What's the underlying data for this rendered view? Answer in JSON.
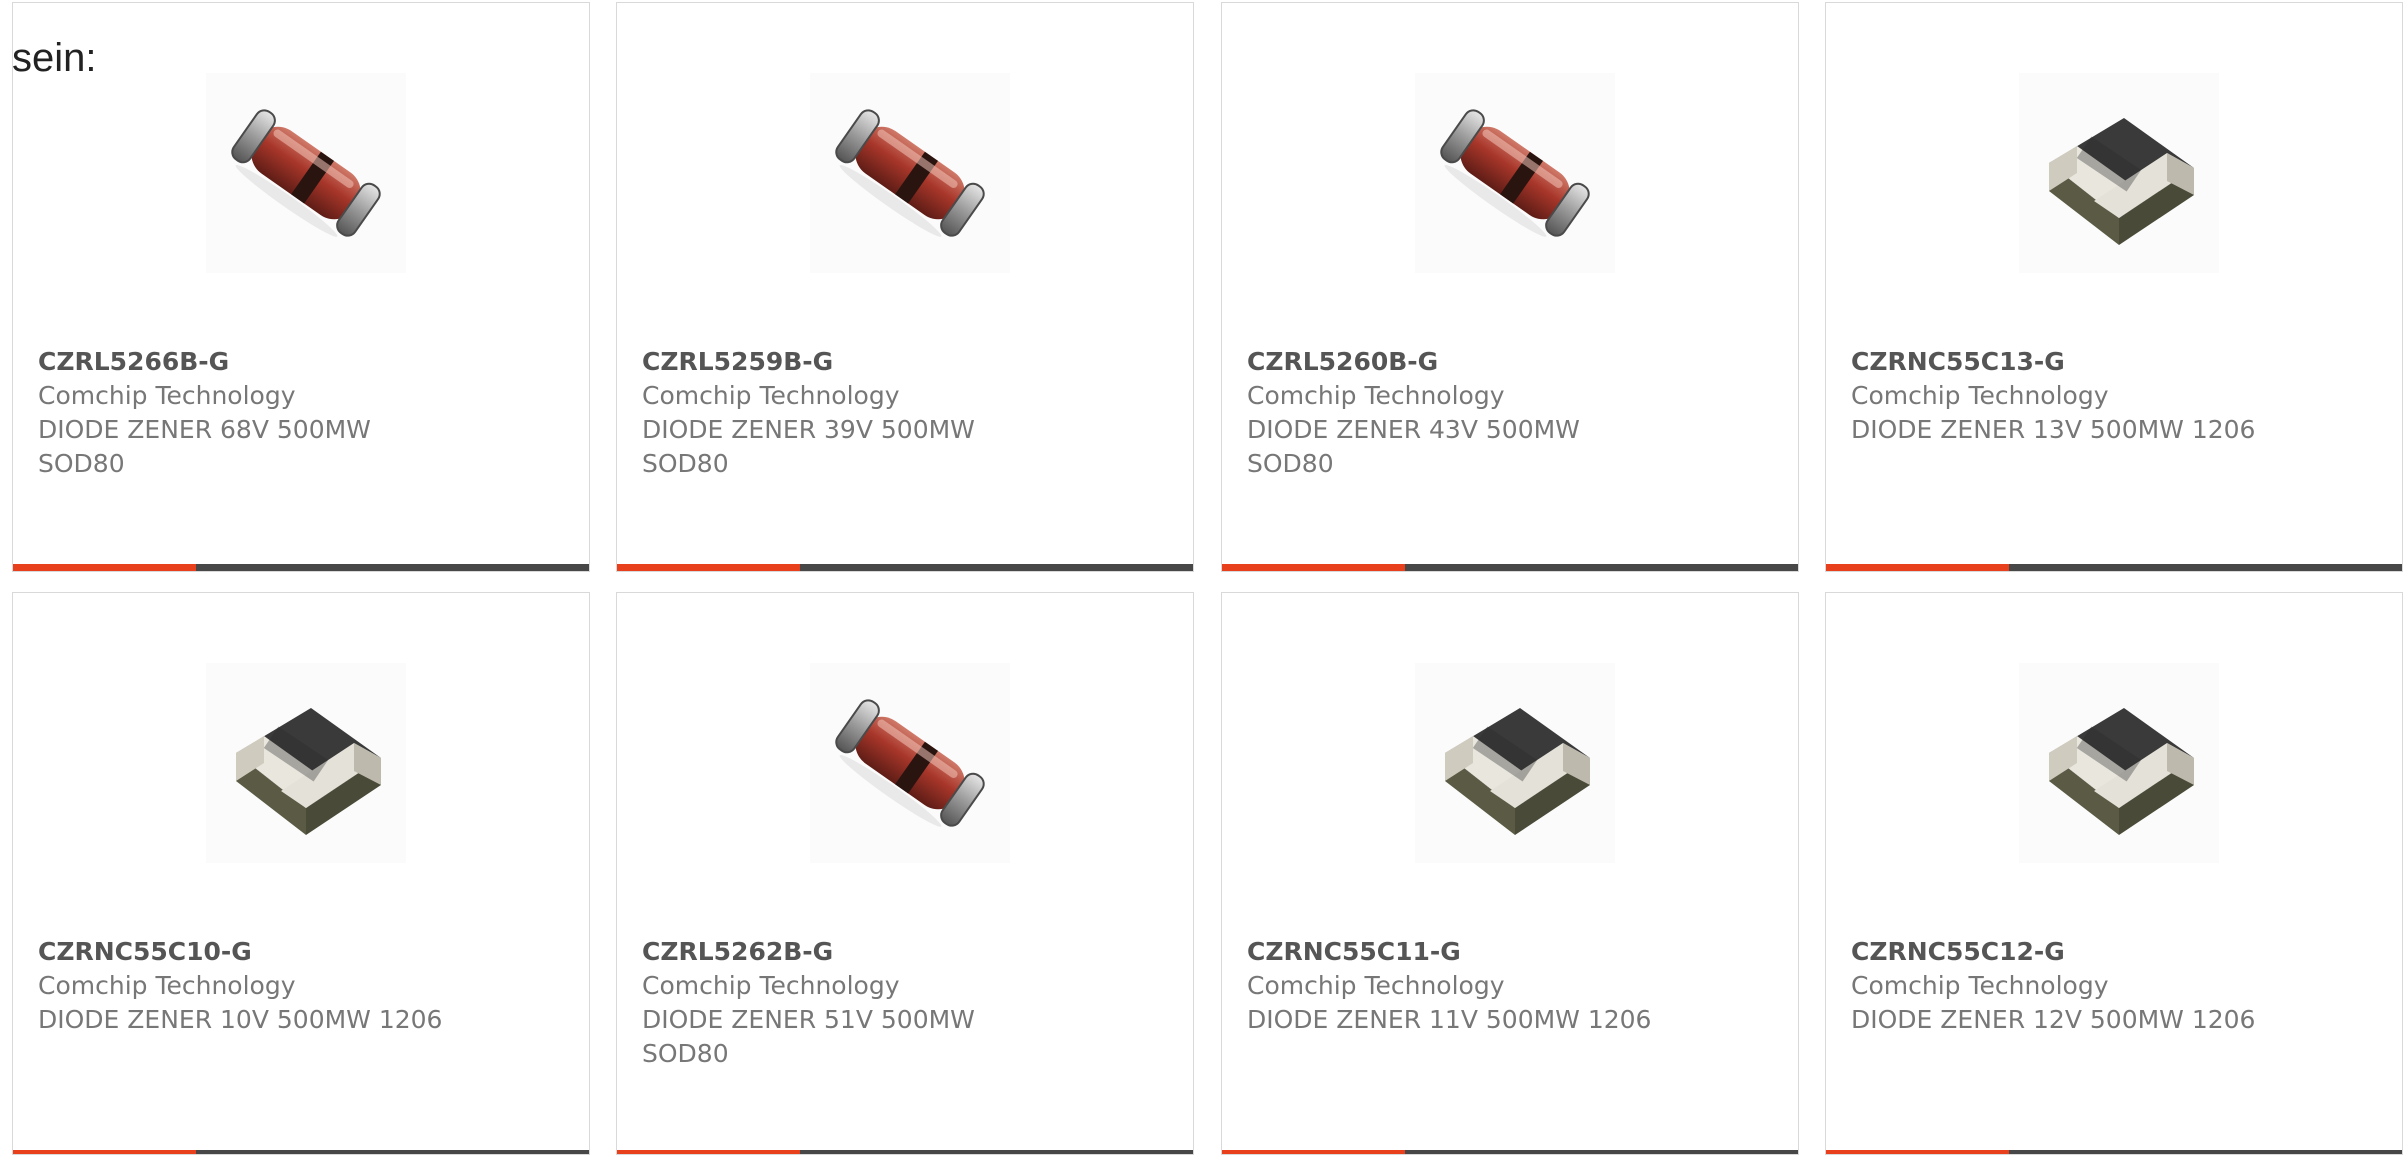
{
  "intro_text": "sein:",
  "colors": {
    "accent": "#e8401c",
    "bar_dark": "#474747",
    "text_part": "#555555",
    "text_body": "#777777",
    "card_border": "#d9d9d9"
  },
  "products": [
    {
      "part": "CZRL5266B-G",
      "manufacturer": "Comchip Technology",
      "description": "DIODE ZENER 68V 500MW\nSOD80",
      "image": "melf-diode-icon"
    },
    {
      "part": "CZRL5259B-G",
      "manufacturer": "Comchip Technology",
      "description": "DIODE ZENER 39V 500MW\nSOD80",
      "image": "melf-diode-icon"
    },
    {
      "part": "CZRL5260B-G",
      "manufacturer": "Comchip Technology",
      "description": "DIODE ZENER 43V 500MW\nSOD80",
      "image": "melf-diode-icon"
    },
    {
      "part": "CZRNC55C13-G",
      "manufacturer": "Comchip Technology",
      "description": "DIODE ZENER 13V 500MW 1206",
      "image": "smd-1206-chip-icon"
    },
    {
      "part": "CZRNC55C10-G",
      "manufacturer": "Comchip Technology",
      "description": "DIODE ZENER 10V 500MW 1206",
      "image": "smd-1206-chip-icon"
    },
    {
      "part": "CZRL5262B-G",
      "manufacturer": "Comchip Technology",
      "description": "DIODE ZENER 51V 500MW\nSOD80",
      "image": "melf-diode-icon"
    },
    {
      "part": "CZRNC55C11-G",
      "manufacturer": "Comchip Technology",
      "description": "DIODE ZENER 11V 500MW 1206",
      "image": "smd-1206-chip-icon"
    },
    {
      "part": "CZRNC55C12-G",
      "manufacturer": "Comchip Technology",
      "description": "DIODE ZENER 12V 500MW 1206",
      "image": "smd-1206-chip-icon"
    }
  ]
}
